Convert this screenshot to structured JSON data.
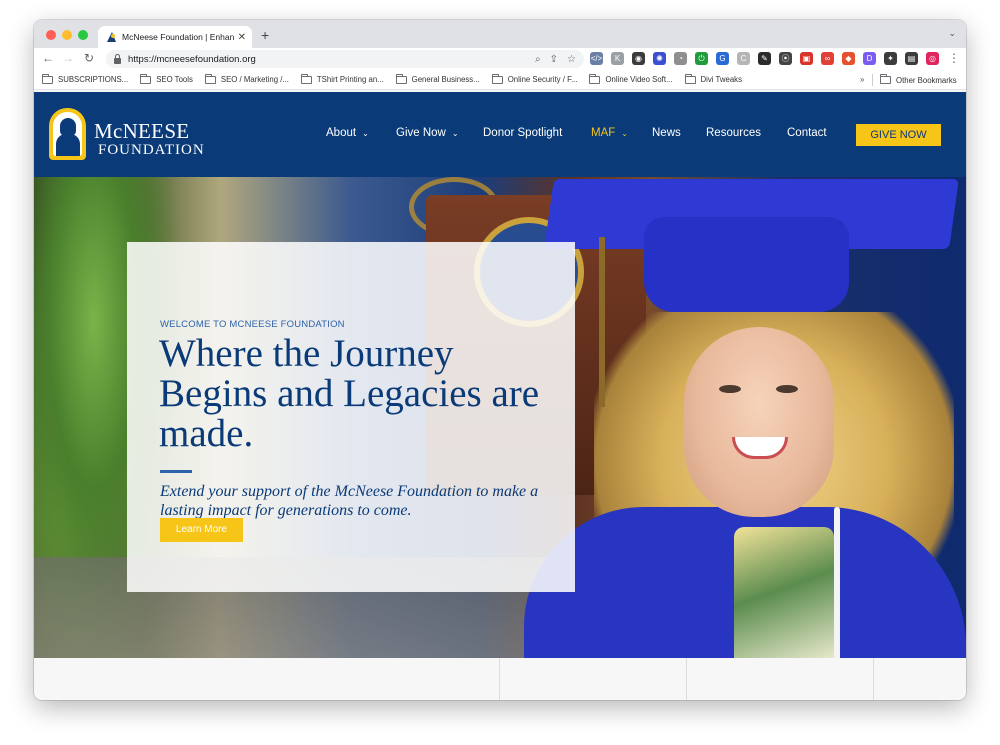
{
  "browser": {
    "tab_title": "McNeese Foundation | Enhanc",
    "tab_close": "✕",
    "new_tab": "+",
    "tab_menu": "⌄",
    "url": "https://mcneesefoundation.org",
    "back": "←",
    "forward": "→",
    "reload": "↻",
    "search_icon": "⌕",
    "share_icon": "⇪",
    "star_icon": "☆",
    "menu_icon": "⋮",
    "extensions": [
      {
        "name": "ext-code-icon",
        "glyph": "</>",
        "color": "#6b7fa6"
      },
      {
        "name": "ext-k-icon",
        "glyph": "K",
        "color": "#9aa0a6"
      },
      {
        "name": "ext-eye-icon",
        "glyph": "◉",
        "color": "#3c3c3c"
      },
      {
        "name": "ext-gear-icon",
        "glyph": "✺",
        "color": "#3b4fd1"
      },
      {
        "name": "ext-pie-icon",
        "glyph": "◔",
        "color": "#8f8f8f"
      },
      {
        "name": "ext-power-icon",
        "glyph": "⏻",
        "color": "#1f9d3b"
      },
      {
        "name": "ext-g-icon",
        "glyph": "G",
        "color": "#2a6ad8"
      },
      {
        "name": "ext-c-icon",
        "glyph": "C",
        "color": "#b5b5b5"
      },
      {
        "name": "ext-pen-icon",
        "glyph": "✎",
        "color": "#2b2b2b"
      },
      {
        "name": "ext-pin-icon",
        "glyph": "⦿",
        "color": "#444444"
      },
      {
        "name": "ext-lock-icon",
        "glyph": "▣",
        "color": "#d9342b"
      },
      {
        "name": "ext-link-icon",
        "glyph": "∞",
        "color": "#e04038"
      },
      {
        "name": "ext-tag-icon",
        "glyph": "◆",
        "color": "#e8512f"
      },
      {
        "name": "ext-d-icon",
        "glyph": "D",
        "color": "#7b5cf0"
      },
      {
        "name": "ext-puzzle-icon",
        "glyph": "✦",
        "color": "#3c3c3c"
      },
      {
        "name": "ext-sidebar-icon",
        "glyph": "▤",
        "color": "#3c3c3c"
      },
      {
        "name": "ext-profile-icon",
        "glyph": "◎",
        "color": "#e0245e"
      }
    ]
  },
  "bookmarks": {
    "items": [
      "SUBSCRIPTIONS...",
      "SEO Tools",
      "SEO / Marketing /...",
      "TShirt Printing an...",
      "General Business...",
      "Online Security / F...",
      "Online Video Soft...",
      "Divi Tweaks"
    ],
    "more": "»",
    "other": "Other Bookmarks"
  },
  "site": {
    "logo_line1": "McNEESE",
    "logo_line2": "FOUNDATION",
    "nav": [
      {
        "label": "About",
        "caret": true,
        "color": "#ffffff"
      },
      {
        "label": "Give Now",
        "caret": true,
        "color": "#ffffff"
      },
      {
        "label": "Donor Spotlight",
        "caret": false,
        "color": "#ffffff"
      },
      {
        "label": "MAF",
        "caret": true,
        "color": "#f6c518"
      },
      {
        "label": "News",
        "caret": false,
        "color": "#ffffff"
      },
      {
        "label": "Resources",
        "caret": false,
        "color": "#ffffff"
      },
      {
        "label": "Contact",
        "caret": false,
        "color": "#ffffff"
      }
    ],
    "caret_glyph": "⌄",
    "give_now_button": "GIVE NOW"
  },
  "hero": {
    "eyebrow": "WELCOME TO MCNEESE FOUNDATION",
    "headline": "Where the Journey Begins and Legacies are made.",
    "subhead": "Extend your support of the McNeese Foundation to make a lasting impact for generations to come.",
    "button": "Learn More"
  },
  "colors": {
    "brand_navy": "#0a3a78",
    "brand_gold": "#f6c518",
    "accent_blue": "#2d63a8"
  }
}
